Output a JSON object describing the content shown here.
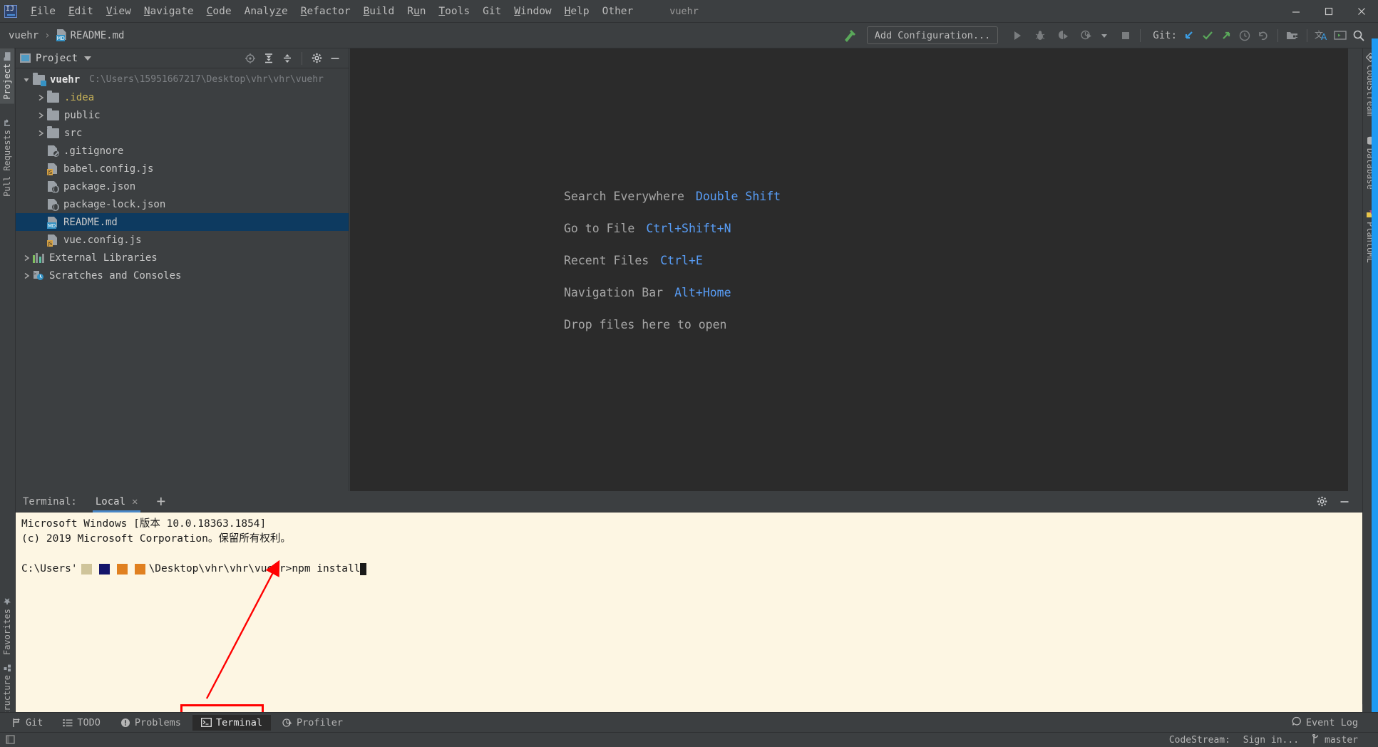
{
  "window": {
    "project_name": "vuehr",
    "minimize": "minimize-icon",
    "maximize": "maximize-icon",
    "close": "close-icon"
  },
  "menubar": {
    "items": [
      {
        "label": "File",
        "mnemonic": "F"
      },
      {
        "label": "Edit",
        "mnemonic": "E"
      },
      {
        "label": "View",
        "mnemonic": "V"
      },
      {
        "label": "Navigate",
        "mnemonic": "N"
      },
      {
        "label": "Code",
        "mnemonic": "C"
      },
      {
        "label": "Analyze",
        "mnemonic": "z"
      },
      {
        "label": "Refactor",
        "mnemonic": "R"
      },
      {
        "label": "Build",
        "mnemonic": "B"
      },
      {
        "label": "Run",
        "mnemonic": "u"
      },
      {
        "label": "Tools",
        "mnemonic": "T"
      },
      {
        "label": "Git",
        "mnemonic": ""
      },
      {
        "label": "Window",
        "mnemonic": "W"
      },
      {
        "label": "Help",
        "mnemonic": "H"
      },
      {
        "label": "Other",
        "mnemonic": ""
      }
    ]
  },
  "toolbar": {
    "breadcrumb": {
      "project": "vuehr",
      "separator": "›",
      "file": "README.md"
    },
    "build_icon": "hammer-icon",
    "add_configuration": "Add Configuration...",
    "run_icon": "run-icon",
    "debug_icon": "debug-icon",
    "run_coverage_icon": "run-with-coverage-icon",
    "profile_icon": "profile-icon",
    "more_icon": "chevron-down-icon",
    "stop_icon": "stop-icon",
    "git_label": "Git:",
    "git_update_icon": "update-project-icon",
    "git_commit_icon": "commit-icon",
    "git_push_icon": "push-icon",
    "git_history_icon": "history-icon",
    "git_rollback_icon": "rollback-icon",
    "project_structure_icon": "project-structure-icon",
    "translate_icon": "translate-icon",
    "terminal_icon": "terminal-icon",
    "search_icon": "search-icon"
  },
  "left_strip": {
    "tabs": [
      {
        "label": "Project",
        "icon": "folder-icon",
        "active": true
      },
      {
        "label": "Pull Requests",
        "icon": "pull-request-icon",
        "active": false
      }
    ],
    "bottom_tabs": [
      {
        "label": "Structure",
        "icon": "structure-icon"
      },
      {
        "label": "Favorites",
        "icon": "star-icon"
      }
    ]
  },
  "right_strip": {
    "tabs": [
      {
        "label": "CodeStream",
        "icon": "codestream-icon"
      },
      {
        "label": "Database",
        "icon": "database-icon"
      },
      {
        "label": "PlantUML",
        "icon": "plantuml-icon"
      }
    ]
  },
  "project_panel": {
    "title": "Project",
    "dropdown_icon": "chevron-down-icon",
    "actions": [
      {
        "name": "scroll-from-source-icon"
      },
      {
        "name": "expand-all-icon"
      },
      {
        "name": "collapse-all-icon"
      },
      {
        "name": "settings-gear-icon"
      },
      {
        "name": "hide-icon"
      }
    ],
    "tree": [
      {
        "label": "vuehr",
        "path": "C:\\Users\\15951667217\\Desktop\\vhr\\vhr\\vuehr",
        "indent": 0,
        "arrow": "down",
        "icon": "module-folder-icon",
        "style": "bold",
        "selected": false
      },
      {
        "label": ".idea",
        "path": "",
        "indent": 1,
        "arrow": "right",
        "icon": "folder-icon",
        "style": "yellow",
        "selected": false
      },
      {
        "label": "public",
        "path": "",
        "indent": 1,
        "arrow": "right",
        "icon": "folder-icon",
        "style": "plain",
        "selected": false
      },
      {
        "label": "src",
        "path": "",
        "indent": 1,
        "arrow": "right",
        "icon": "folder-icon",
        "style": "plain",
        "selected": false
      },
      {
        "label": ".gitignore",
        "path": "",
        "indent": 1,
        "arrow": "none",
        "icon": "gitignore-file-icon",
        "style": "plain",
        "selected": false
      },
      {
        "label": "babel.config.js",
        "path": "",
        "indent": 1,
        "arrow": "none",
        "icon": "js-file-icon",
        "style": "plain",
        "selected": false
      },
      {
        "label": "package.json",
        "path": "",
        "indent": 1,
        "arrow": "none",
        "icon": "json-file-icon",
        "style": "plain",
        "selected": false
      },
      {
        "label": "package-lock.json",
        "path": "",
        "indent": 1,
        "arrow": "none",
        "icon": "json-file-icon",
        "style": "plain",
        "selected": false
      },
      {
        "label": "README.md",
        "path": "",
        "indent": 1,
        "arrow": "none",
        "icon": "md-file-icon",
        "style": "plain",
        "selected": true
      },
      {
        "label": "vue.config.js",
        "path": "",
        "indent": 1,
        "arrow": "none",
        "icon": "js-file-icon",
        "style": "plain",
        "selected": false
      },
      {
        "label": "External Libraries",
        "path": "",
        "indent": 0,
        "arrow": "right",
        "icon": "libraries-icon",
        "style": "plain",
        "selected": false
      },
      {
        "label": "Scratches and Consoles",
        "path": "",
        "indent": 0,
        "arrow": "right",
        "icon": "scratches-icon",
        "style": "plain",
        "selected": false
      }
    ]
  },
  "editor": {
    "hints": [
      {
        "label": "Search Everywhere",
        "key": "Double Shift"
      },
      {
        "label": "Go to File",
        "key": "Ctrl+Shift+N"
      },
      {
        "label": "Recent Files",
        "key": "Ctrl+E"
      },
      {
        "label": "Navigation Bar",
        "key": "Alt+Home"
      },
      {
        "label": "Drop files here to open",
        "key": ""
      }
    ]
  },
  "terminal": {
    "title": "Terminal:",
    "tabs": [
      {
        "label": "Local",
        "active": true,
        "close_icon": "close-icon"
      }
    ],
    "new_tab_icon": "plus-icon",
    "settings_icon": "settings-gear-icon",
    "hide_icon": "hide-icon",
    "lines": [
      {
        "text": "Microsoft Windows [版本 10.0.18363.1854]",
        "type": "plain"
      },
      {
        "text": "(c) 2019 Microsoft Corporation。保留所有权利。",
        "type": "plain"
      },
      {
        "text": "",
        "type": "plain"
      },
      {
        "type": "prompt",
        "prefix": "C:\\Users'",
        "redactions": [
          "#cfc49a",
          "#14156b",
          "#e08020",
          "#e08020"
        ],
        "suffix": "\\Desktop\\vhr\\vhr\\vuehr>",
        "command": "npm install"
      }
    ]
  },
  "annotation": {
    "arrow": "red-arrow-pointing-to-terminal-tab",
    "highlight_box": "red-box-around-terminal-tab",
    "color": "#ff0000"
  },
  "bottom_bar": {
    "tabs": [
      {
        "label": "Git",
        "icon": "git-icon",
        "active": false
      },
      {
        "label": "TODO",
        "icon": "todo-icon",
        "active": false
      },
      {
        "label": "Problems",
        "icon": "problems-icon",
        "active": false
      },
      {
        "label": "Terminal",
        "icon": "terminal-icon",
        "active": true
      },
      {
        "label": "Profiler",
        "icon": "profiler-icon",
        "active": false
      }
    ],
    "event_log": {
      "label": "Event Log",
      "icon": "balloon-icon"
    }
  },
  "status_bar": {
    "left_icon": "toggle-toolbar-icon",
    "codestream": "CodeStream:",
    "sign_in": "Sign in...",
    "branch": "master",
    "branch_icon": "git-branch-icon"
  },
  "colors": {
    "accent_blue": "#589df6",
    "selection": "#0d3a60",
    "terminal_bg": "#fdf6e3",
    "panel_bg": "#3c3f41",
    "editor_bg": "#2b2b2b",
    "annotation_red": "#ff0000",
    "tab_underline": "#4a88c7"
  }
}
